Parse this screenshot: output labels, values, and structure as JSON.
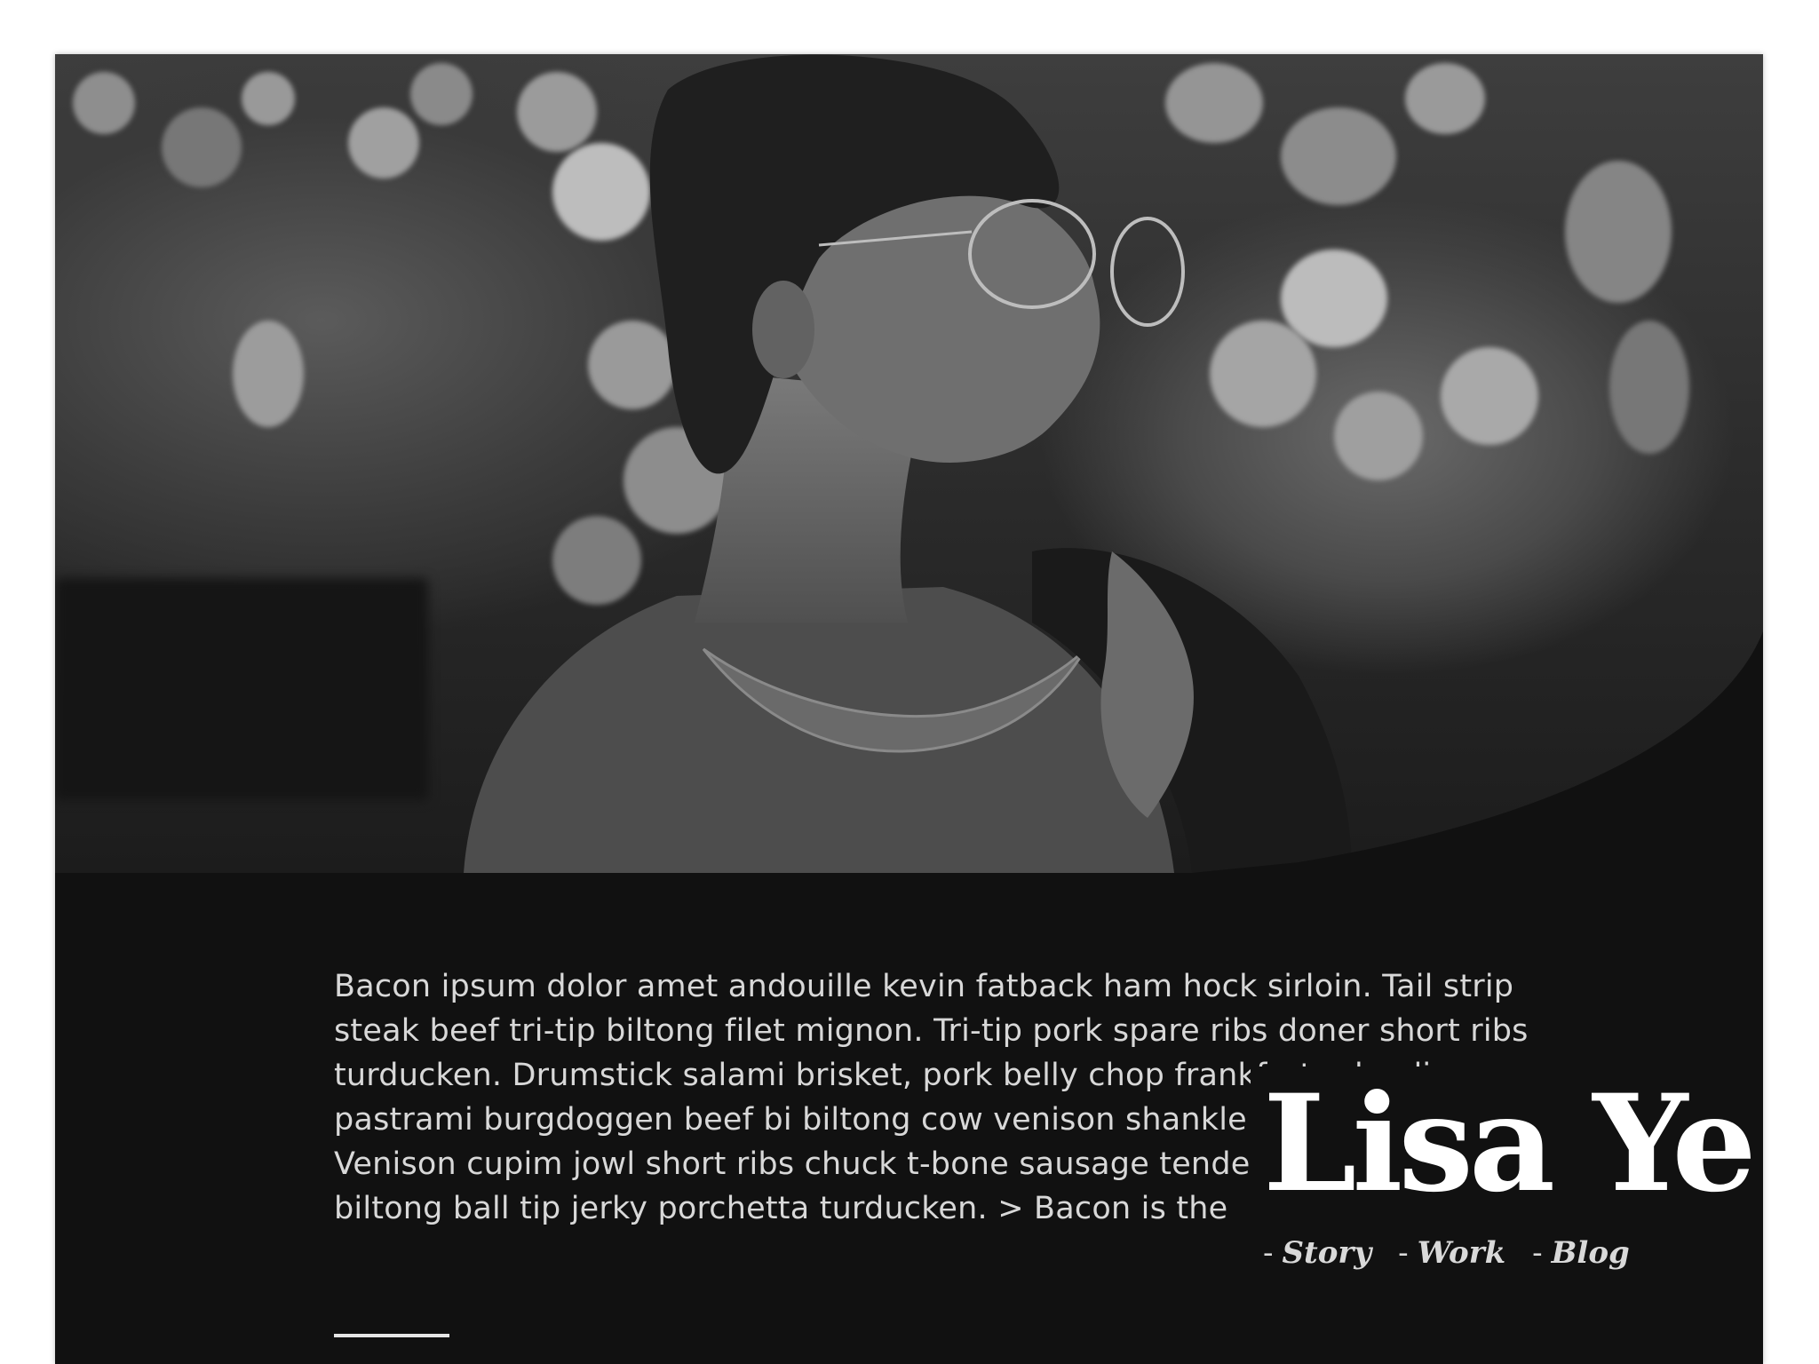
{
  "hero": {
    "image_description_icon": "portrait-photo"
  },
  "bio": {
    "text": "Bacon ipsum dolor amet andouille kevin fatback ham hock sirloin. Tail strip steak beef tri-tip biltong filet mignon. Tri-tip pork spare ribs doner short ribs turducken. Drumstick salami brisket, pork belly chop frankfurter landjaeger pastrami burgdoggen beef bi biltong cow venison shankle tail picanha. Venison cupim jowl short ribs chuck t-bone sausage tenderloin. Tail pork biltong ball tip jerky porchetta turducken. > Bacon is the"
  },
  "identity": {
    "name": "Lisa Ye"
  },
  "nav": {
    "items": [
      {
        "dash": "-",
        "label": "Story"
      },
      {
        "dash": "-",
        "label": "Work"
      },
      {
        "dash": "-",
        "label": "Blog"
      }
    ]
  },
  "colors": {
    "page_background": "#111111",
    "text_primary": "#ffffff",
    "text_body": "#d8d8d8",
    "outer_background": "#ffffff"
  }
}
